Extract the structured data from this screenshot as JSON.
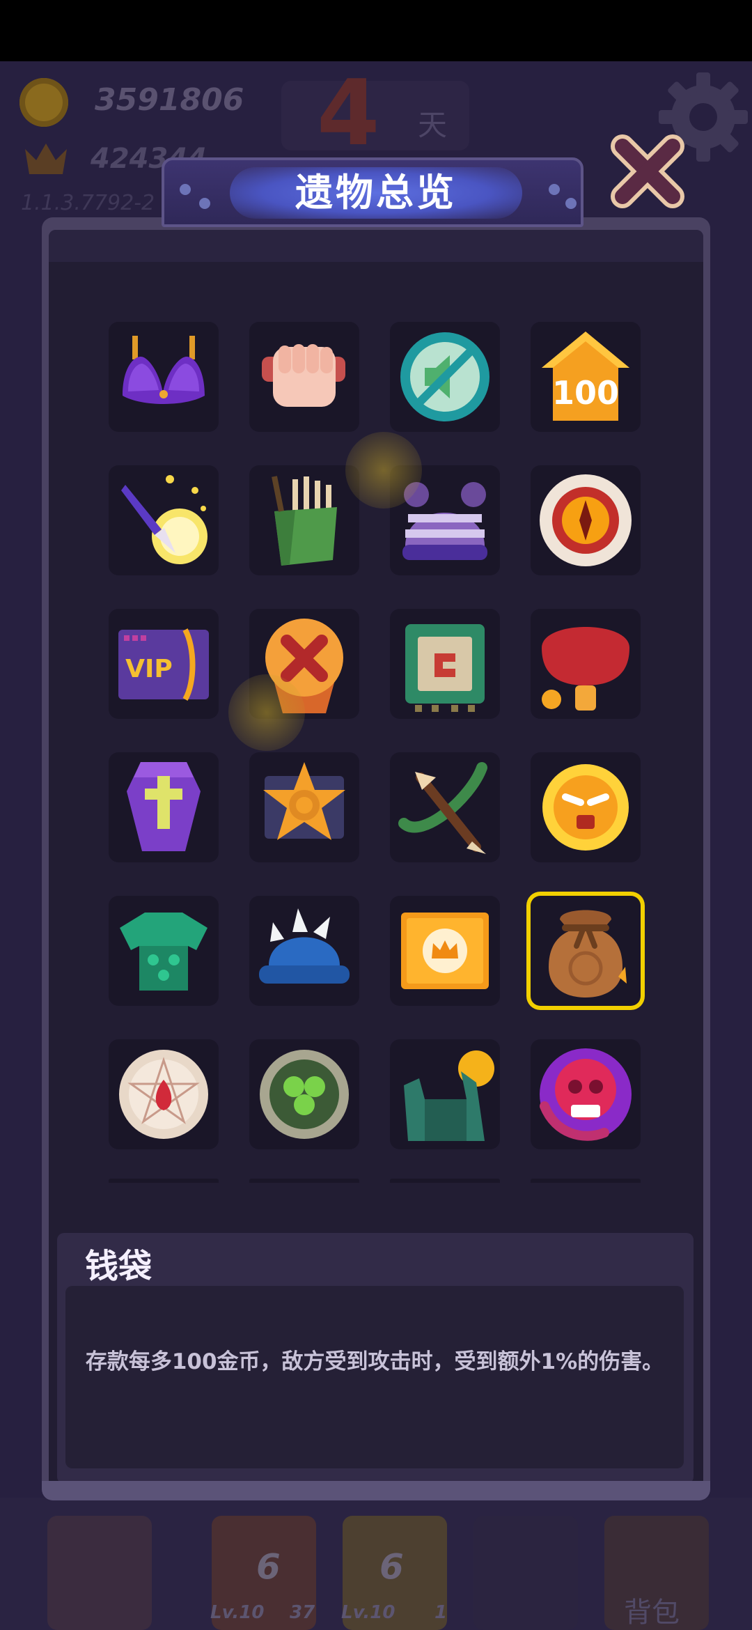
{
  "hud": {
    "gold": "3591806",
    "crown_value": "424344",
    "version": "1.1.3.7792-2",
    "day_number": "4",
    "day_label": "天",
    "bag_label": "背包",
    "slots": [
      {
        "num": "6",
        "level": "Lv.10",
        "count": "37"
      },
      {
        "num": "6",
        "level": "Lv.10",
        "count": "1"
      }
    ]
  },
  "modal": {
    "title": "遗物总览",
    "close_icon": "close-x-icon",
    "relics": [
      {
        "name": "bra-relic-icon"
      },
      {
        "name": "fist-relic-icon"
      },
      {
        "name": "mute-relic-icon"
      },
      {
        "name": "house-100-relic-icon",
        "label": "100"
      },
      {
        "name": "arrow-coin-relic-icon"
      },
      {
        "name": "quiver-relic-icon"
      },
      {
        "name": "beanie-relic-icon"
      },
      {
        "name": "eye-relic-icon"
      },
      {
        "name": "vip-card-relic-icon",
        "label": "VIP"
      },
      {
        "name": "x-shield-relic-icon"
      },
      {
        "name": "chip-relic-icon"
      },
      {
        "name": "ping-pong-paddle-relic-icon"
      },
      {
        "name": "coffin-relic-icon"
      },
      {
        "name": "sheriff-badge-relic-icon"
      },
      {
        "name": "crossbow-relic-icon"
      },
      {
        "name": "angry-sun-relic-icon"
      },
      {
        "name": "green-armor-relic-icon"
      },
      {
        "name": "spiked-helmet-relic-icon"
      },
      {
        "name": "crown-card-relic-icon"
      },
      {
        "name": "money-bag-relic-icon"
      },
      {
        "name": "pentagram-plate-relic-icon"
      },
      {
        "name": "clover-coin-relic-icon"
      },
      {
        "name": "zombie-coin-relic-icon"
      },
      {
        "name": "skull-relic-icon"
      }
    ],
    "selected_index": 19,
    "selected_item": {
      "title": "钱袋",
      "description": "存款每多100金币，敌方受到攻击时，受到额外1%的伤害。"
    }
  },
  "colors": {
    "background": "#211b33",
    "panel": "#221d33",
    "selection": "#f2d000",
    "title_glow": "#5d6fe0"
  }
}
